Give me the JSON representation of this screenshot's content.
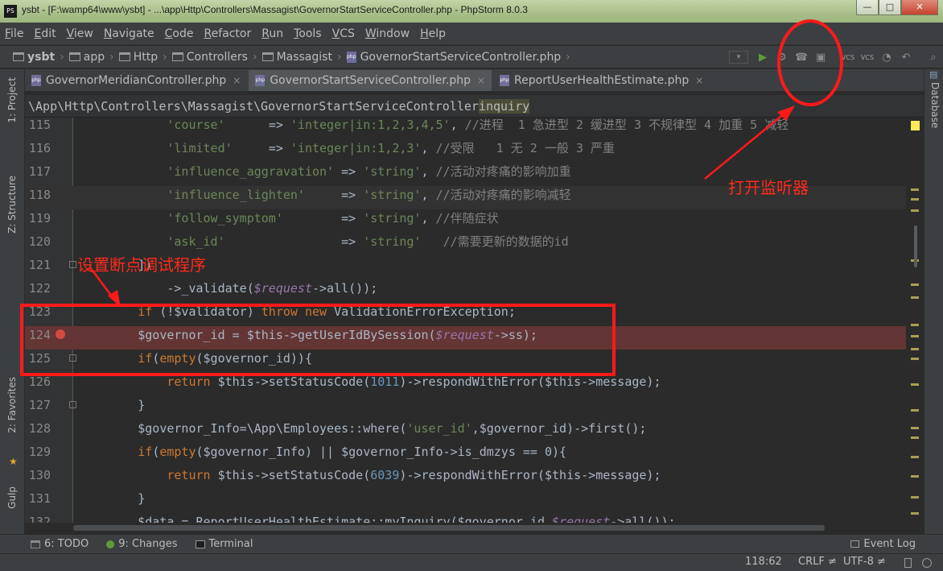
{
  "window": {
    "title": "ysbt - [F:\\wamp64\\www\\ysbt] - ...\\app\\Http\\Controllers\\Massagist\\GovernorStartServiceController.php - PhpStorm 8.0.3",
    "icon_label": "PS",
    "min_label": "—",
    "max_label": "□",
    "close_label": "✕"
  },
  "menu": [
    "File",
    "Edit",
    "View",
    "Navigate",
    "Code",
    "Refactor",
    "Run",
    "Tools",
    "VCS",
    "Window",
    "Help"
  ],
  "breadcrumbs": [
    "ysbt",
    "app",
    "Http",
    "Controllers",
    "Massagist",
    "GovernorStartServiceController.php"
  ],
  "toolbar": {
    "dropdown": "▾",
    "run": "▶",
    "debug": "⚙",
    "listener": "☎",
    "listener2": "▣",
    "vcs1": "VCS",
    "vcs2": "VCS",
    "history": "◔",
    "revert": "↶",
    "search": "⌕"
  },
  "left_tools": [
    "1: Project",
    "Z: Structure",
    "2: Favorites",
    "Gulp"
  ],
  "right_tools": [
    "Database"
  ],
  "tabs": [
    {
      "label": "GovernorMeridianController.php",
      "active": false
    },
    {
      "label": "GovernorStartServiceController.php",
      "active": true
    },
    {
      "label": "ReportUserHealthEstimate.php",
      "active": false
    }
  ],
  "tab_close": "×",
  "scope": {
    "path": "\\App\\Http\\Controllers\\Massagist\\GovernorStartServiceController",
    "method": "inquiry"
  },
  "code_lines": [
    {
      "num": "115",
      "text": "            'course'      => 'integer|in:1,2,3,4,5', //进程  1 急进型 2 缓进型 3 不规律型 4 加重 5 减轻"
    },
    {
      "num": "116",
      "text": "            'limited'     => 'integer|in:1,2,3', //受限   1 无 2 一般 3 严重"
    },
    {
      "num": "117",
      "text": "            'influence_aggravation' => 'string', //活动对疼痛的影响加重"
    },
    {
      "num": "118",
      "text": "            'influence_lighten'     => 'string', //活动对疼痛的影响减轻"
    },
    {
      "num": "119",
      "text": "            'follow_symptom'        => 'string', //伴随症状"
    },
    {
      "num": "120",
      "text": "            'ask_id'                => 'string'   //需要更新的数据的id"
    },
    {
      "num": "121",
      "text": "        ])"
    },
    {
      "num": "122",
      "text": "            ->_validate($request->all());"
    },
    {
      "num": "123",
      "text": "        if (!$validator) throw new ValidationErrorException;"
    },
    {
      "num": "124",
      "text": "        $governor_id = $this->getUserIdBySession($request->ss);"
    },
    {
      "num": "125",
      "text": "        if(empty($governor_id)){"
    },
    {
      "num": "126",
      "text": "            return $this->setStatusCode(1011)->respondWithError($this->message);"
    },
    {
      "num": "127",
      "text": "        }"
    },
    {
      "num": "128",
      "text": "        $governor_Info=\\App\\Employees::where('user_id',$governor_id)->first();"
    },
    {
      "num": "129",
      "text": "        if(empty($governor_Info) || $governor_Info->is_dmzys == 0){"
    },
    {
      "num": "130",
      "text": "            return $this->setStatusCode(6039)->respondWithError($this->message);"
    },
    {
      "num": "131",
      "text": "        }"
    },
    {
      "num": "132",
      "text": "        $data = ReportUserHealthEstimate::myInquiry($governor_id,$request->all());"
    }
  ],
  "bottom_tools": [
    {
      "label": "6: TODO",
      "icon": "todo-icon"
    },
    {
      "label": "9: Changes",
      "icon": "changes-icon"
    },
    {
      "label": "Terminal",
      "icon": "terminal-icon"
    }
  ],
  "event_log": "Event Log",
  "status": {
    "position": "118:62",
    "line_sep": "CRLF ≠",
    "encoding": "UTF-8 ≠"
  },
  "annotations": {
    "listener": "打开监听器",
    "breakpoint": "设置断点调试程序"
  },
  "colors": {
    "annotation": "#ff1a1a",
    "breakpoint_line": "#633534",
    "keyword": "#cc7832",
    "string": "#6a8759"
  }
}
